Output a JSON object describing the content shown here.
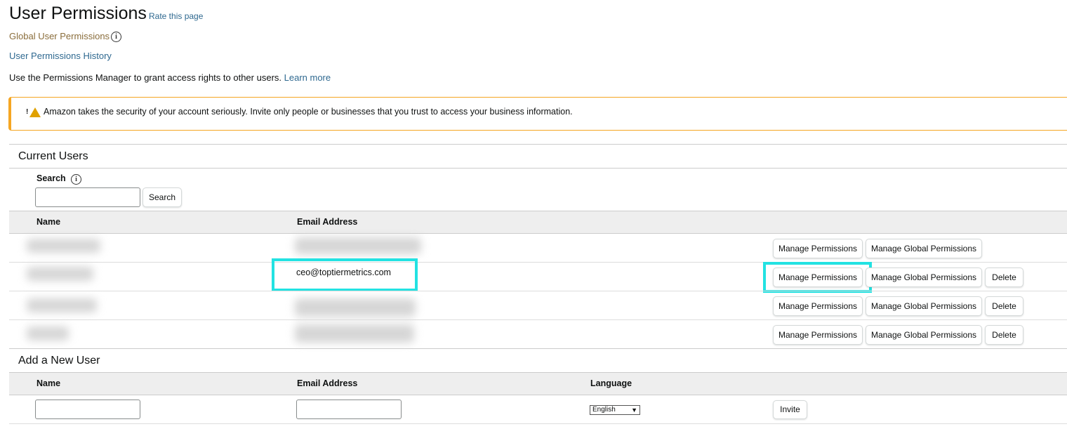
{
  "header": {
    "title": "User Permissions",
    "rate_link": "Rate this page",
    "global_link": "Global User Permissions",
    "info_glyph": "i",
    "history_link": "User Permissions History",
    "description": "Use the Permissions Manager to grant access rights to other users.",
    "learn_more": "Learn more"
  },
  "alert": {
    "icon": "warning-icon",
    "icon_glyph": "!",
    "text": "Amazon takes the security of your account seriously. Invite only people or businesses that you trust to access your business information.",
    "accent_color": "#f5a623"
  },
  "current_users": {
    "title": "Current Users",
    "search_label": "Search",
    "search_value": "",
    "search_button": "Search",
    "columns": [
      "Name",
      "Email Address"
    ],
    "rows": [
      {
        "name": "",
        "email": "",
        "actions": [
          "Manage Permissions",
          "Manage Global Permissions"
        ]
      },
      {
        "name": "",
        "email": "ceo@toptiermetrics.com",
        "actions": [
          "Manage Permissions",
          "Manage Global Permissions",
          "Delete"
        ]
      },
      {
        "name": "",
        "email": "",
        "actions": [
          "Manage Permissions",
          "Manage Global Permissions",
          "Delete"
        ]
      },
      {
        "name": "",
        "email": "",
        "actions": [
          "Manage Permissions",
          "Manage Global Permissions",
          "Delete"
        ]
      }
    ]
  },
  "add_user": {
    "title": "Add a New User",
    "columns": [
      "Name",
      "Email Address",
      "Language"
    ],
    "name_value": "",
    "email_value": "",
    "language_selected": "English",
    "invite_button": "Invite"
  },
  "highlight_color": "#22e2e2"
}
